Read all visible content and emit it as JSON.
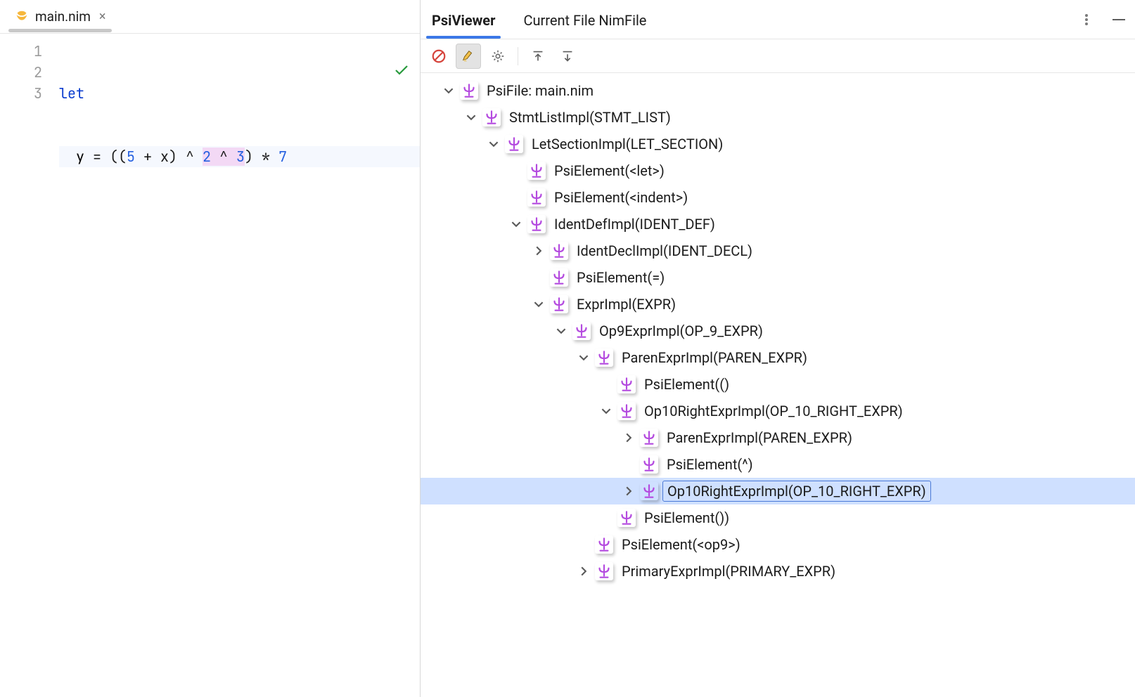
{
  "editor": {
    "file_name": "main.nim",
    "line_numbers": [
      "1",
      "2",
      "3"
    ],
    "tokens_line1": [
      {
        "t": "let",
        "cls": "tok-kw"
      }
    ],
    "tokens_line2": [
      {
        "t": "  y ",
        "cls": "tok-id"
      },
      {
        "t": "= ((",
        "cls": ""
      },
      {
        "t": "5",
        "cls": "tok-num"
      },
      {
        "t": " + x) ^ ",
        "cls": ""
      },
      {
        "t": "2",
        "cls": "tok-num tok-sel"
      },
      {
        "t": " ",
        "cls": "tok-sel"
      },
      {
        "t": "^",
        "cls": "tok-sel"
      },
      {
        "t": " ",
        "cls": "tok-sel"
      },
      {
        "t": "3",
        "cls": "tok-num tok-sel"
      },
      {
        "t": ") * ",
        "cls": ""
      },
      {
        "t": "7",
        "cls": "tok-num"
      }
    ]
  },
  "psi": {
    "tabs": {
      "viewer": "PsiViewer",
      "current": "Current File NimFile"
    },
    "toolbar": {
      "block": "block-icon",
      "highlight": "highlight-icon",
      "settings": "settings-icon",
      "collapse": "collapse-icon",
      "expand": "expand-icon"
    },
    "tree": [
      {
        "depth": 0,
        "tw": "down",
        "label": "PsiFile: main.nim"
      },
      {
        "depth": 1,
        "tw": "down",
        "label": "StmtListImpl(STMT_LIST)"
      },
      {
        "depth": 2,
        "tw": "down",
        "label": "LetSectionImpl(LET_SECTION)"
      },
      {
        "depth": 3,
        "tw": "none",
        "label": "PsiElement(<let>)"
      },
      {
        "depth": 3,
        "tw": "none",
        "label": "PsiElement(<indent>)"
      },
      {
        "depth": 3,
        "tw": "down",
        "label": "IdentDefImpl(IDENT_DEF)"
      },
      {
        "depth": 4,
        "tw": "right",
        "label": "IdentDeclImpl(IDENT_DECL)"
      },
      {
        "depth": 4,
        "tw": "none",
        "label": "PsiElement(=)"
      },
      {
        "depth": 4,
        "tw": "down",
        "label": "ExprImpl(EXPR)"
      },
      {
        "depth": 5,
        "tw": "down",
        "label": "Op9ExprImpl(OP_9_EXPR)"
      },
      {
        "depth": 6,
        "tw": "down",
        "label": "ParenExprImpl(PAREN_EXPR)"
      },
      {
        "depth": 7,
        "tw": "none",
        "label": "PsiElement(()"
      },
      {
        "depth": 7,
        "tw": "down",
        "label": "Op10RightExprImpl(OP_10_RIGHT_EXPR)"
      },
      {
        "depth": 8,
        "tw": "right",
        "label": "ParenExprImpl(PAREN_EXPR)"
      },
      {
        "depth": 8,
        "tw": "none",
        "label": "PsiElement(^)"
      },
      {
        "depth": 8,
        "tw": "right",
        "label": "Op10RightExprImpl(OP_10_RIGHT_EXPR)",
        "selected": true
      },
      {
        "depth": 7,
        "tw": "none",
        "label": "PsiElement())"
      },
      {
        "depth": 6,
        "tw": "none",
        "label": "PsiElement(<op9>)"
      },
      {
        "depth": 6,
        "tw": "right",
        "label": "PrimaryExprImpl(PRIMARY_EXPR)"
      }
    ]
  }
}
